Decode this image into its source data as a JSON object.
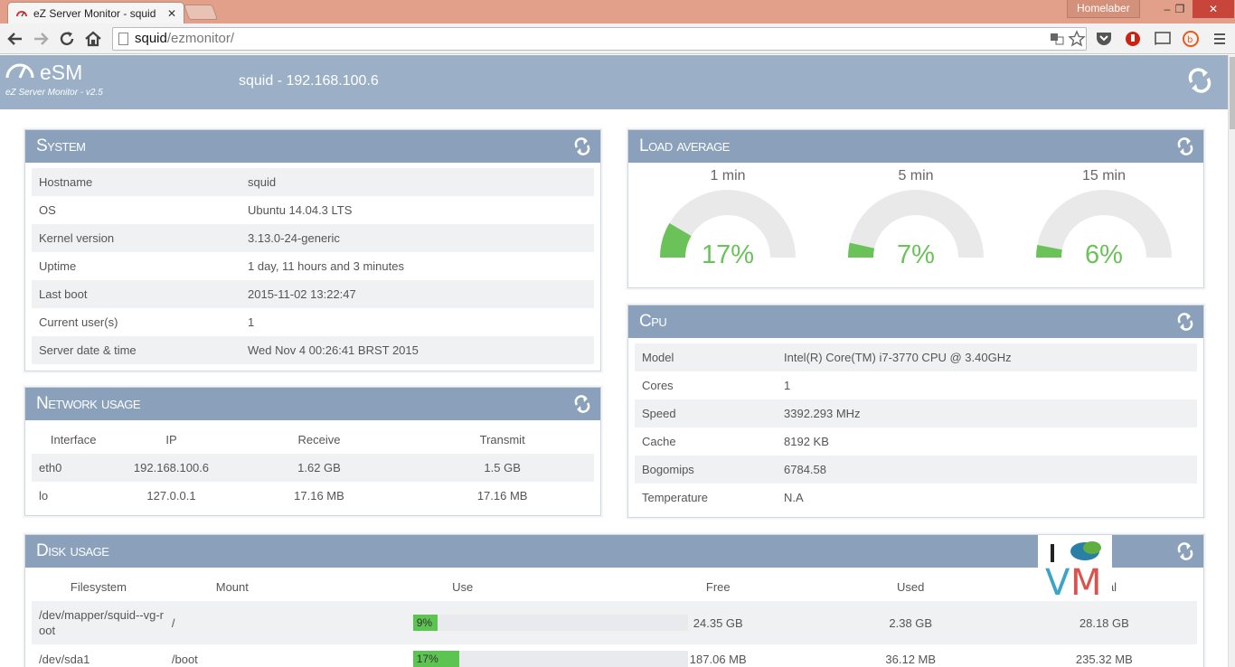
{
  "browser": {
    "tab_title": "eZ Server Monitor - squid",
    "tab_close": "✕",
    "profile_name": "Homelaber",
    "url_host": "squid",
    "url_path": "/ezmonitor/",
    "win_min": "–",
    "win_max": "❐",
    "win_close": "✕"
  },
  "header": {
    "app_name": "eSM",
    "app_subtitle": "eZ Server Monitor - v2.5",
    "host_line": "squid - 192.168.100.6"
  },
  "system": {
    "title": "System",
    "rows": [
      {
        "label": "Hostname",
        "value": "squid"
      },
      {
        "label": "OS",
        "value": "Ubuntu 14.04.3 LTS"
      },
      {
        "label": "Kernel version",
        "value": "3.13.0-24-generic"
      },
      {
        "label": "Uptime",
        "value": "1 day, 11 hours and 3 minutes"
      },
      {
        "label": "Last boot",
        "value": "2015-11-02 13:22:47"
      },
      {
        "label": "Current user(s)",
        "value": "1"
      },
      {
        "label": "Server date & time",
        "value": "Wed Nov 4 00:26:41 BRST 2015"
      }
    ]
  },
  "network": {
    "title": "Network usage",
    "headers": [
      "Interface",
      "IP",
      "Receive",
      "Transmit"
    ],
    "rows": [
      [
        "eth0",
        "192.168.100.6",
        "1.62 GB",
        "1.5 GB"
      ],
      [
        "lo",
        "127.0.0.1",
        "17.16 MB",
        "17.16 MB"
      ]
    ]
  },
  "load": {
    "title": "Load average",
    "gauges": [
      {
        "label": "1 min",
        "value": "17%",
        "percent": 17
      },
      {
        "label": "5 min",
        "value": "7%",
        "percent": 7
      },
      {
        "label": "15 min",
        "value": "6%",
        "percent": 6
      }
    ]
  },
  "cpu": {
    "title": "Cpu",
    "rows": [
      {
        "label": "Model",
        "value": "Intel(R) Core(TM) i7-3770 CPU @ 3.40GHz"
      },
      {
        "label": "Cores",
        "value": "1"
      },
      {
        "label": "Speed",
        "value": "3392.293 MHz"
      },
      {
        "label": "Cache",
        "value": "8192 KB"
      },
      {
        "label": "Bogomips",
        "value": "6784.58"
      },
      {
        "label": "Temperature",
        "value": "N.A"
      }
    ]
  },
  "disk": {
    "title": "Disk usage",
    "headers": [
      "Filesystem",
      "Mount",
      "Use",
      "Free",
      "Used",
      "Total"
    ],
    "rows": [
      {
        "filesystem": "/dev/mapper/squid--vg-root",
        "mount": "/",
        "use": "9%",
        "percent": 9,
        "free": "24.35 GB",
        "used": "2.38 GB",
        "total": "28.18 GB"
      },
      {
        "filesystem": "/dev/sda1",
        "mount": "/boot",
        "use": "17%",
        "percent": 17,
        "free": "187.06 MB",
        "used": "36.12 MB",
        "total": "235.32 MB"
      }
    ]
  },
  "colors": {
    "header_bg": "#9bb0c7",
    "box_head_bg": "#8ba1bb",
    "gauge_green": "#6ac259",
    "bar_green": "#5cc552"
  }
}
